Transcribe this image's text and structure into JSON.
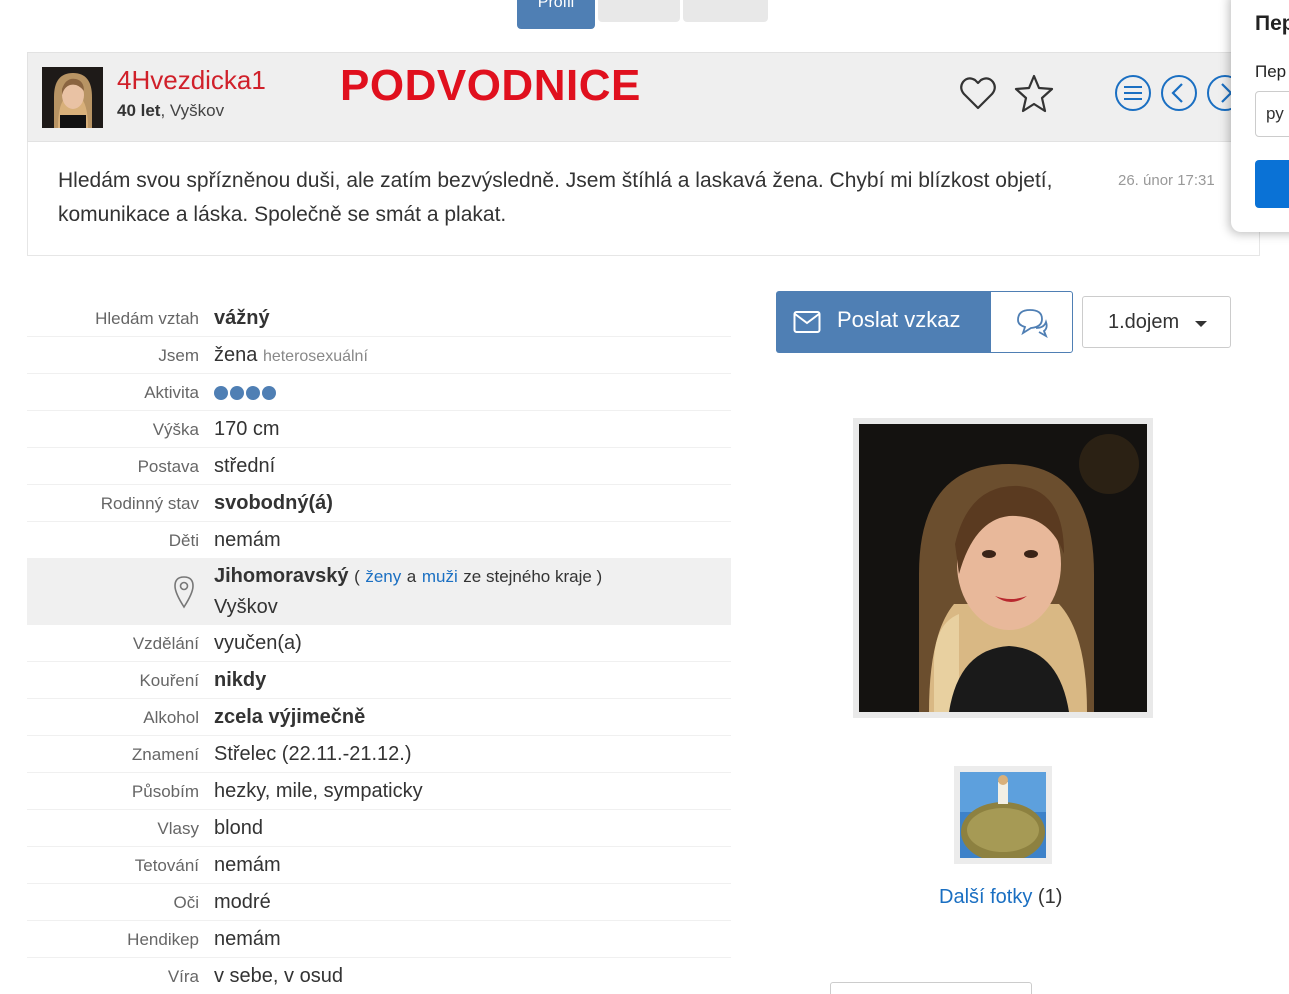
{
  "top_tabs": [
    {
      "label": "Profil"
    },
    {
      "label": ""
    },
    {
      "label": ""
    }
  ],
  "header": {
    "username": "4Hvezdicka1",
    "age": "40 let",
    "city": ", Vyškov",
    "warning": "PODVODNICE"
  },
  "intro": {
    "text": "Hledám svou spřízněnou duši, ale zatím bezvýsledně. Jsem štíhlá a laskavá žena. Chybí mi blízkost objetí, komunikace a láska. Společně se smát a plakat.",
    "date": "26. únor 17:31"
  },
  "popup": {
    "title": "Пер",
    "label": "Пер",
    "input_value": "ру"
  },
  "profile": {
    "rows_top": [
      {
        "label": "Hledám vztah",
        "value": "vážný",
        "bold": true
      },
      {
        "label": "Jsem",
        "value": "žena",
        "extra": "heterosexuální"
      },
      {
        "label": "Aktivita",
        "dots": 4
      },
      {
        "label": "Výška",
        "value": "170 cm"
      },
      {
        "label": "Postava",
        "value": "střední"
      },
      {
        "label": "Rodinný stav",
        "value": "svobodný(á)",
        "bold": true
      },
      {
        "label": "Děti",
        "value": "nemám"
      }
    ],
    "location": {
      "region": "Jihomoravský",
      "open_paren": "(",
      "link_women": "ženy",
      "and": "a",
      "link_men": "muži",
      "rest": "ze stejného kraje )",
      "city": "Vyškov"
    },
    "rows_bottom": [
      {
        "label": "Vzdělání",
        "value": "vyučen(a)"
      },
      {
        "label": "Kouření",
        "value": "nikdy",
        "bold": true
      },
      {
        "label": "Alkohol",
        "value": "zcela výjimečně",
        "bold": true
      },
      {
        "label": "Znamení",
        "value": "Střelec (22.11.-21.12.)"
      },
      {
        "label": "Působím",
        "value": "hezky, mile, sympaticky"
      },
      {
        "label": "Vlasy",
        "value": "blond"
      },
      {
        "label": "Tetování",
        "value": "nemám"
      },
      {
        "label": "Oči",
        "value": "modré"
      },
      {
        "label": "Hendikep",
        "value": "nemám"
      },
      {
        "label": "Víra",
        "value": "v sebe, v osud"
      }
    ]
  },
  "actions": {
    "send_message": "Poslat vzkaz",
    "first_impression": "1.dojem"
  },
  "photos": {
    "more_label": "Další fotky",
    "more_count": "(1)"
  },
  "colors": {
    "accent": "#4f7fb4",
    "username": "#d0202a",
    "warning": "#e0101e",
    "link": "#1a6fc2"
  }
}
